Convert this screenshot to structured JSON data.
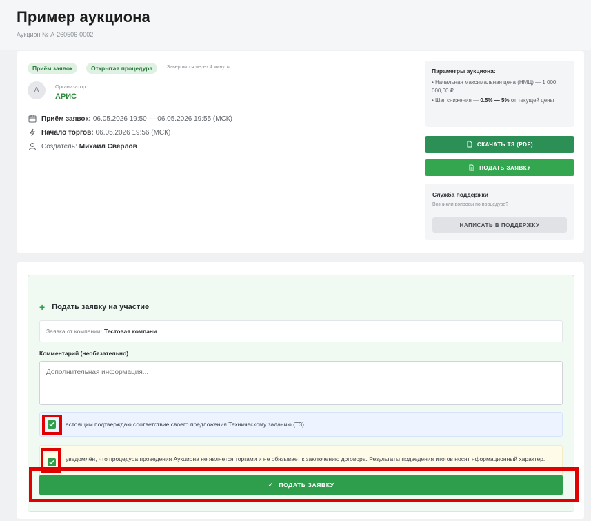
{
  "header": {
    "title": "Пример аукциона",
    "subtitle": "Аукцион № А-260506-0002"
  },
  "auction": {
    "badges": {
      "status": "Приём заявок",
      "type": "Открытая процедура"
    },
    "ends_note": "Завершится через 4 минуты",
    "organizer_label": "Организатор",
    "organizer_name": "АРИС",
    "avatar_letter": "A",
    "rows": {
      "applications_label": "Приём заявок:",
      "applications_value": "06.05.2026 19:50 — 06.05.2026 19:55 (МСК)",
      "trading_label": "Начало торгов:",
      "trading_value": "06.05.2026 19:56 (МСК)",
      "creator_label": "Создатель:",
      "creator_value": "Михаил Сверлов"
    }
  },
  "params": {
    "title": "Параметры аукциона:",
    "nmc_label": "• Начальная максимальная цена (НМЦ) — 1 000 000,00 ₽",
    "step_prefix": "• Шаг снижения —",
    "step_range": "0.5% — 5%",
    "step_suffix": "от текущей цены"
  },
  "actions": {
    "download_label": "СКАЧАТЬ ТЗ (PDF)",
    "apply_label": "ПОДАТЬ ЗАЯВКУ"
  },
  "support": {
    "title": "Служба поддержки",
    "text": "Возникли вопросы по процедуре?",
    "button_label": "НАПИСАТЬ В ПОДДЕРЖКУ"
  },
  "form": {
    "title": "Подать заявку на участие",
    "company_label": "Заявка от компании:",
    "company_name": "Тестовая компани",
    "comment_label": "Комментарий (необязательно)",
    "comment_placeholder": "Дополнительная информация...",
    "check1_text": "астоящим подтверждаю соответствие своего предложения Техническому заданию (ТЗ).",
    "check1_checked": true,
    "check2_text": "уведомлён, что процедура проведения Аукциона не является торгами и не обязывает к заключению договора. Результаты подведения итогов носят нформационный характер.",
    "check2_checked": true,
    "submit_label": "ПОДАТЬ ЗАЯВКУ"
  },
  "colors": {
    "accent_green": "#2f9e4c",
    "highlight_red": "#e00000"
  }
}
